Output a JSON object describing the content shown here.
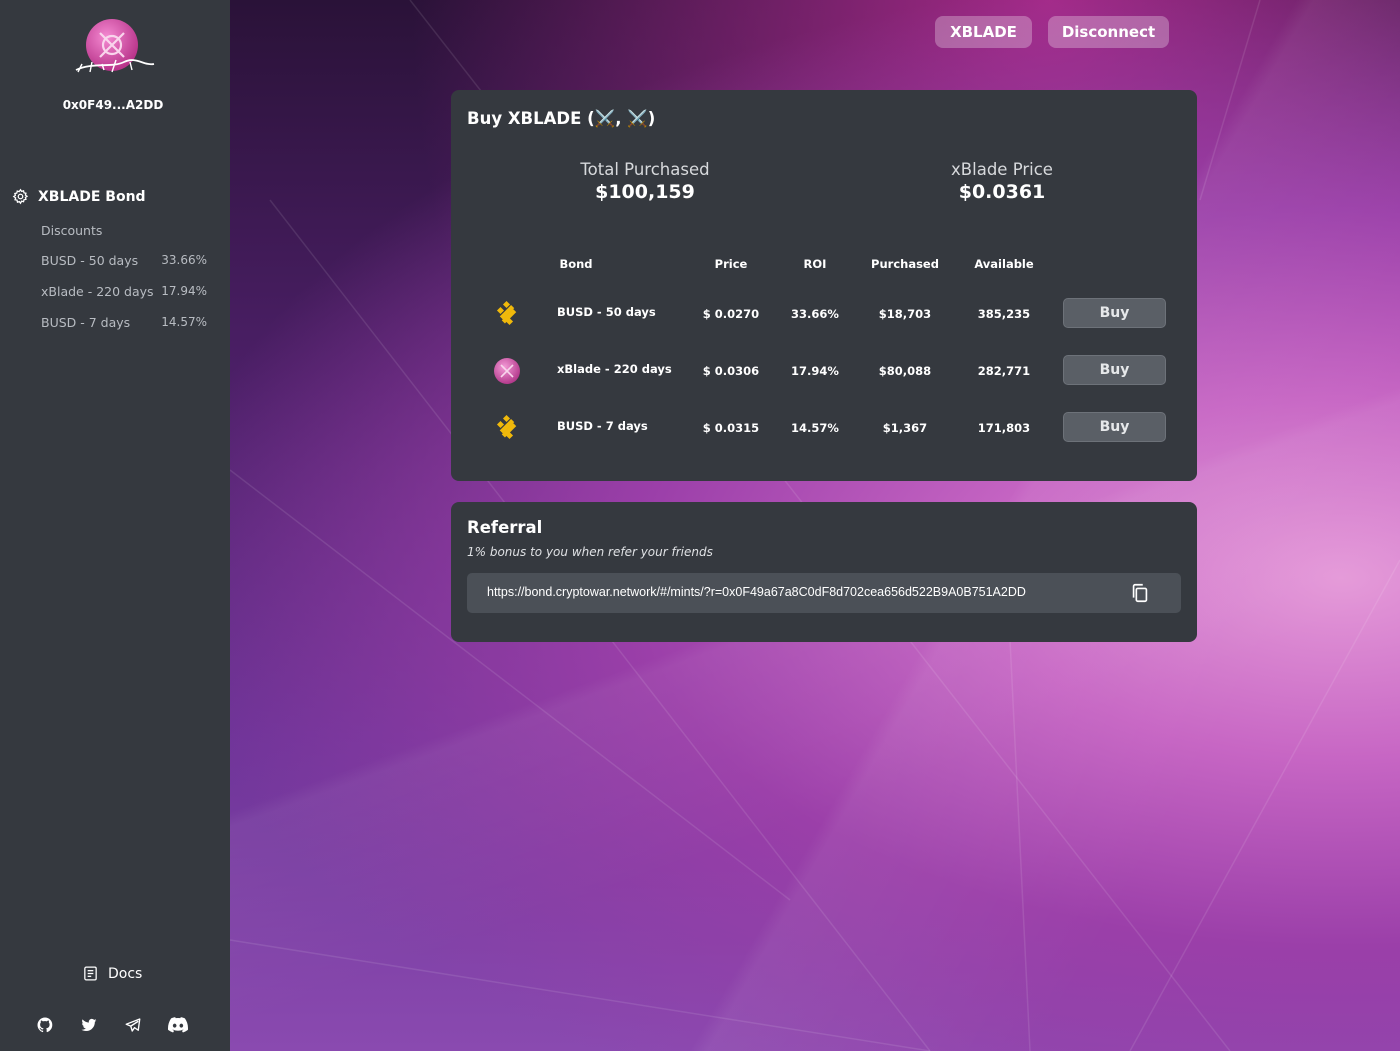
{
  "sidebar": {
    "wallet": "0x0F49...A2DD",
    "nav_title": "XBLADE Bond",
    "discounts_label": "Discounts",
    "discounts": [
      {
        "name": "BUSD - 50 days",
        "pct": "33.66%"
      },
      {
        "name": "xBlade - 220 days",
        "pct": "17.94%"
      },
      {
        "name": "BUSD - 7 days",
        "pct": "14.57%"
      }
    ],
    "docs_label": "Docs",
    "socials": [
      "github-icon",
      "twitter-icon",
      "telegram-icon",
      "discord-icon"
    ]
  },
  "header": {
    "token_button": "XBLADE",
    "disconnect_button": "Disconnect"
  },
  "buy_card": {
    "title": "Buy XBLADE (⚔️, ⚔️)",
    "total_purchased_label": "Total Purchased",
    "total_purchased_value": "$100,159",
    "price_label": "xBlade Price",
    "price_value": "$0.0361",
    "columns": [
      "Bond",
      "Price",
      "ROI",
      "Purchased",
      "Available"
    ],
    "rows": [
      {
        "icon": "busd-icon",
        "bond": "BUSD - 50 days",
        "price": "$  0.0270",
        "roi": "33.66%",
        "purchased": "$18,703",
        "available": "385,235",
        "action": "Buy"
      },
      {
        "icon": "xblade-icon",
        "bond": "xBlade - 220 days",
        "price": "$  0.0306",
        "roi": "17.94%",
        "purchased": "$80,088",
        "available": "282,771",
        "action": "Buy"
      },
      {
        "icon": "busd-icon",
        "bond": "BUSD - 7 days",
        "price": "$  0.0315",
        "roi": "14.57%",
        "purchased": "$1,367",
        "available": "171,803",
        "action": "Buy"
      }
    ]
  },
  "referral": {
    "title": "Referral",
    "subtitle": "1% bonus to you when refer your friends",
    "url": "https://bond.cryptowar.network/#/mints/?r=0x0F49a67a8C0dF8d702cea656d522B9A0B751A2DD"
  },
  "colors": {
    "sidebar": "#35393f",
    "card": "#35393f",
    "busd": "#f0b90b",
    "xblade": "#d44fa6"
  }
}
